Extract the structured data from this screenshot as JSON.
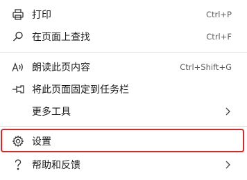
{
  "menu": {
    "items": [
      {
        "label": "打印",
        "shortcut": "Ctrl+P",
        "icon": "printer-icon"
      },
      {
        "label": "在页面上查找",
        "shortcut": "Ctrl+F",
        "icon": "search-icon"
      },
      {
        "label": "朗读此页内容",
        "shortcut": "Ctrl+Shift+G",
        "icon": "read-aloud-icon"
      },
      {
        "label": "将此页面固定到任务栏",
        "icon": "pin-icon"
      },
      {
        "label": "更多工具",
        "icon": "chevron-right-icon"
      },
      {
        "label": "设置",
        "icon": "gear-icon"
      },
      {
        "label": "帮助和反馈",
        "icon": "help-icon"
      }
    ],
    "highlight_color": "#e02424"
  }
}
